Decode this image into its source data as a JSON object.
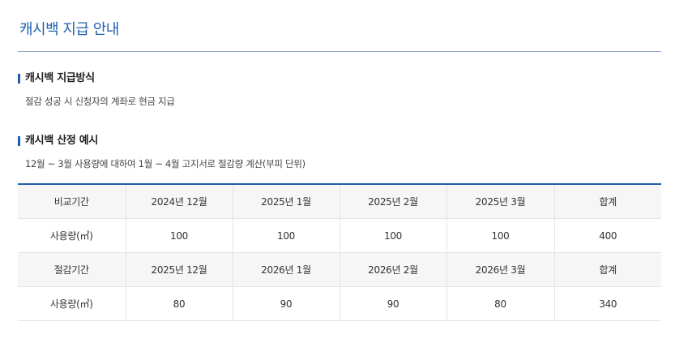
{
  "page": {
    "title": "캐시백 지급 안내"
  },
  "section1": {
    "heading": "캐시백 지급방식",
    "text": "절감 성공 시 신청자의 계좌로 현금 지급"
  },
  "section2": {
    "heading": "캐시백 산정 예시",
    "text": "12월 ~ 3월 사용량에 대하여 1월 ~ 4월 고지서로 절감량 계산(부피 단위)"
  },
  "table": {
    "rows": [
      [
        "비교기간",
        "2024년 12월",
        "2025년 1월",
        "2025년 2월",
        "2025년 3월",
        "합계"
      ],
      [
        "사용량(㎥)",
        "100",
        "100",
        "100",
        "100",
        "400"
      ],
      [
        "절감기간",
        "2025년 12월",
        "2026년 1월",
        "2026년 2월",
        "2026년 3월",
        "합계"
      ],
      [
        "사용량(㎥)",
        "80",
        "90",
        "90",
        "80",
        "340"
      ]
    ]
  },
  "colors": {
    "accent": "#1f5fb0",
    "header_row_bg": "#f6f6f6",
    "border": "#e4e4e4"
  }
}
